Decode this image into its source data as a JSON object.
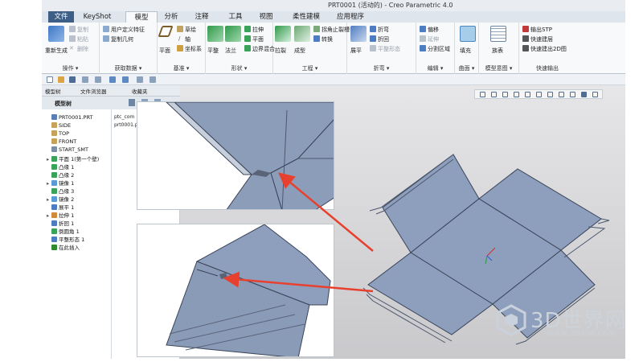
{
  "window": {
    "title": "PRT0001 (活动的) - Creo Parametric 4.0"
  },
  "tabs": [
    "文件",
    "KeyShot",
    "模型",
    "分析",
    "注释",
    "工具",
    "视图",
    "柔性建模",
    "应用程序"
  ],
  "ribbon": {
    "operations": {
      "regen": "重新生成",
      "copy": "复制",
      "paste": "粘贴",
      "delete": "删除",
      "label": "操作 ▾"
    },
    "get_data": {
      "udf": "用户定义特征",
      "copy_geom": "复制几何",
      "label": "获取数据 ▾"
    },
    "datum": {
      "plane": "平面",
      "sketch": "草绘",
      "axis": "轴",
      "csys": "坐标系",
      "label": "基准 ▾"
    },
    "shapes": {
      "flat": "平整",
      "flange": "法兰",
      "extrude": "拉伸",
      "planar": "平面",
      "blend": "边界混合",
      "label": "形状 ▾"
    },
    "engineering": {
      "rip": "拉裂",
      "form": "成型",
      "corner": "拐角止裂槽",
      "convert": "转换",
      "label": "工程 ▾"
    },
    "bends": {
      "unbend": "展平",
      "bend": "折弯",
      "bendback": "折回",
      "flatform": "平整形态",
      "label": "折弯 ▾"
    },
    "editing": {
      "mirror": "偏移",
      "merge": "延伸",
      "split": "分割区域",
      "label": "编辑 ▾"
    },
    "surfaces": {
      "fill": "填充",
      "label": "曲面 ▾"
    },
    "model_intent": {
      "table": "族表",
      "label": "模型意图 ▾"
    },
    "quick_export": {
      "stp": "输出STP",
      "layer": "快速建层",
      "dwg": "快速建出2D图",
      "label": "快速输出"
    }
  },
  "panel": {
    "tabs": [
      "模型树",
      "文件浏览器",
      "收藏夹"
    ],
    "header": "模型树",
    "col2_header": "ptc_com",
    "col2_value": "prt0001.p",
    "items": [
      {
        "label": "PRT0001.PRT",
        "exp": "",
        "color": "#5b7fb5"
      },
      {
        "label": "SIDE",
        "exp": "",
        "color": "#c7a35a"
      },
      {
        "label": "TOP",
        "exp": "",
        "color": "#c7a35a"
      },
      {
        "label": "FRONT",
        "exp": "",
        "color": "#c7a35a"
      },
      {
        "label": "START_SMT",
        "exp": "",
        "color": "#7a8ea6"
      },
      {
        "label": "平面 1(第一个壁)",
        "exp": "▸",
        "color": "#3aa35a"
      },
      {
        "label": "凸缘 1",
        "exp": "",
        "color": "#3aa35a"
      },
      {
        "label": "凸缘 2",
        "exp": "",
        "color": "#3aa35a"
      },
      {
        "label": "镜像 1",
        "exp": "▸",
        "color": "#5a9ad6"
      },
      {
        "label": "凸缘 3",
        "exp": "",
        "color": "#3aa35a"
      },
      {
        "label": "镜像 2",
        "exp": "▸",
        "color": "#5a9ad6"
      },
      {
        "label": "展平 1",
        "exp": "",
        "color": "#4e7cc2"
      },
      {
        "label": "拉伸 1",
        "exp": "▸",
        "color": "#d08a3a"
      },
      {
        "label": "折回 1",
        "exp": "",
        "color": "#4e7cc2"
      },
      {
        "label": "倒圆角 1",
        "exp": "",
        "color": "#3aa35a"
      },
      {
        "label": "平整形态 1",
        "exp": "",
        "color": "#4e7cc2"
      },
      {
        "label": "在此插入",
        "exp": "",
        "color": "#2e8b2e"
      }
    ]
  },
  "watermark": {
    "text": "3D世界网",
    "url": "WWW.3DSJW.COM"
  }
}
